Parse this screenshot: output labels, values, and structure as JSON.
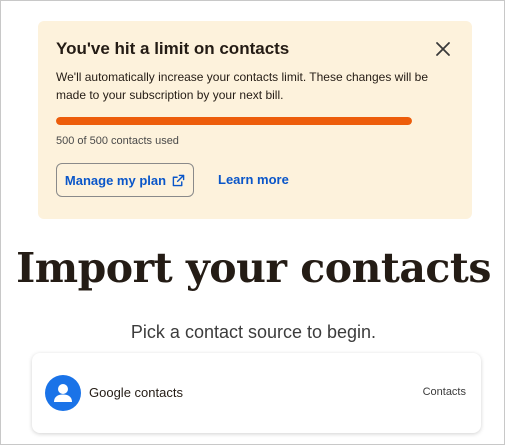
{
  "notice": {
    "title": "You've hit a limit on contacts",
    "body": "We'll automatically increase your contacts limit. These changes will be made to your subscription by your next bill.",
    "usage_text": "500 of 500 contacts used",
    "usage_fraction": 1.0,
    "progress_color": "#ed5d0b",
    "manage_label": "Manage my plan",
    "learn_more_label": "Learn more",
    "close_icon": "close-icon",
    "external_icon": "external-link-icon"
  },
  "main": {
    "title": "Import your contacts",
    "subtitle": "Pick a contact source to begin."
  },
  "sources": [
    {
      "name": "Google contacts",
      "type": "Contacts",
      "icon": "person-icon",
      "icon_color": "#1a73e8"
    }
  ]
}
